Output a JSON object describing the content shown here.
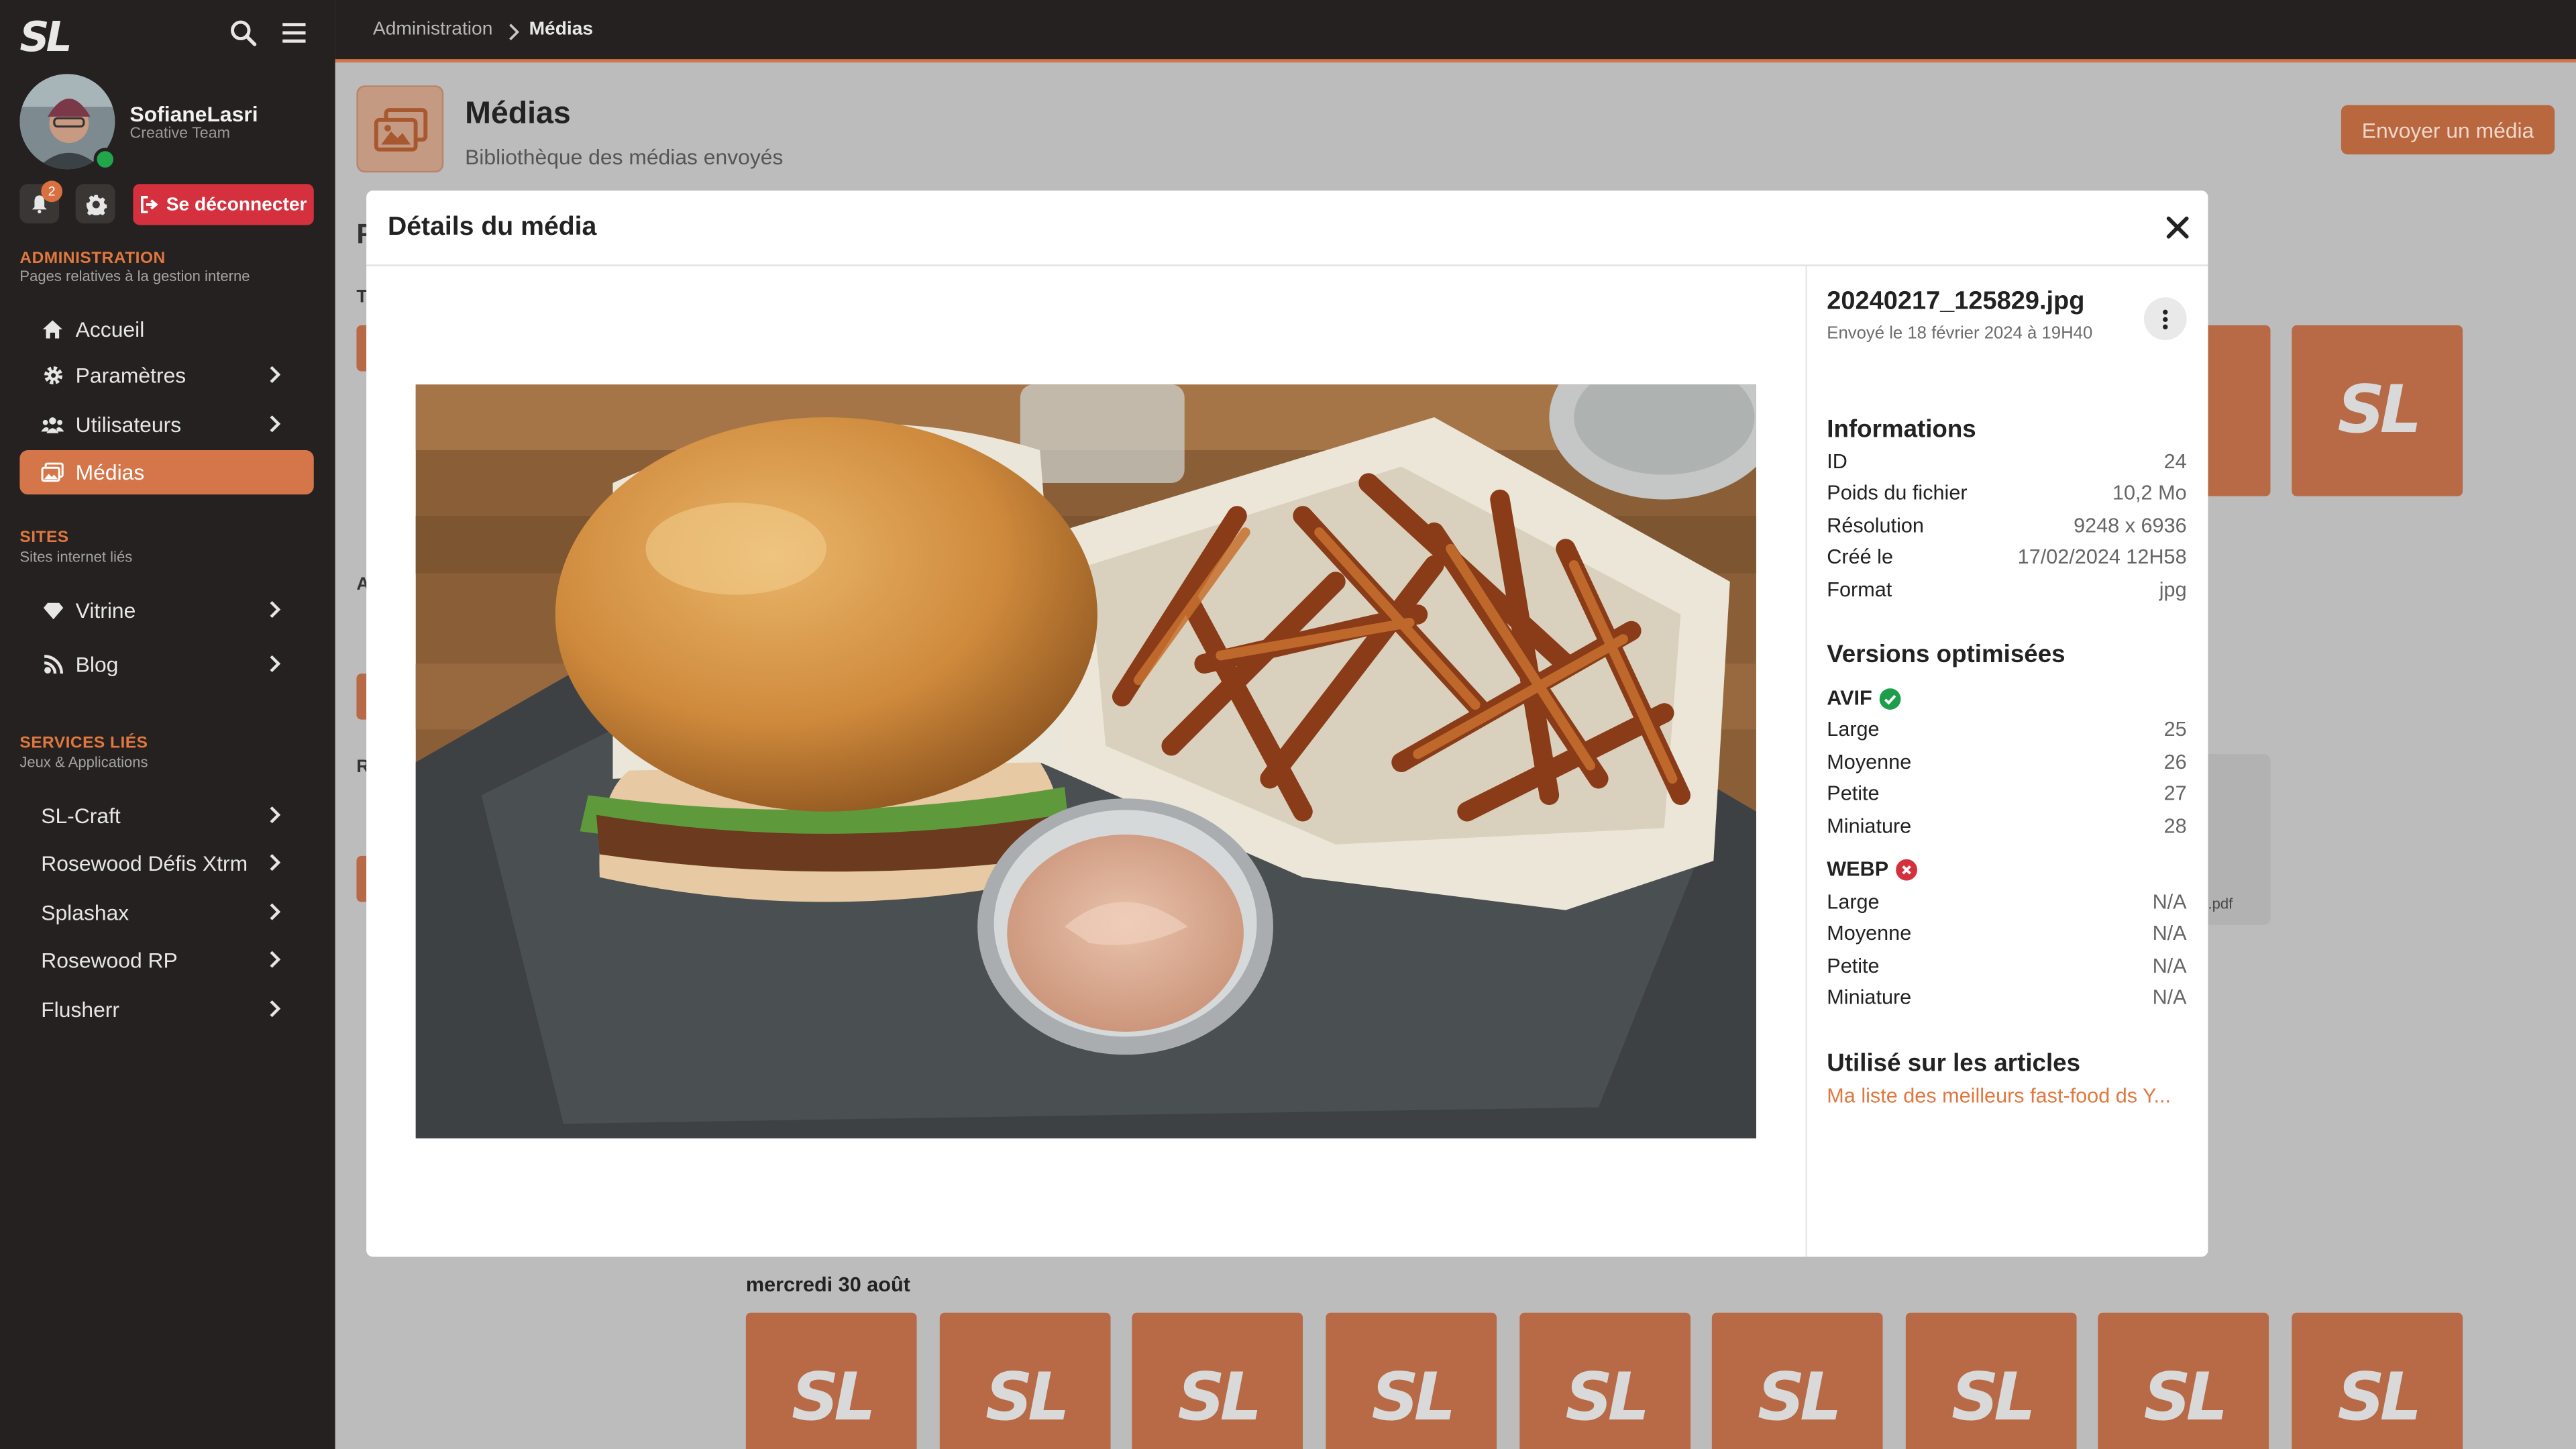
{
  "sidebar": {
    "user": {
      "name": "SofianeLasri",
      "role": "Creative Team"
    },
    "notification_count": "2",
    "logout_label": "Se déconnecter",
    "sections": [
      {
        "title": "Administration",
        "subtitle": "Pages relatives à la gestion interne",
        "items": [
          {
            "label": "Accueil"
          },
          {
            "label": "Paramètres"
          },
          {
            "label": "Utilisateurs"
          },
          {
            "label": "Médias"
          }
        ]
      },
      {
        "title": "Sites",
        "subtitle": "Sites internet liés",
        "items": [
          {
            "label": "Vitrine"
          },
          {
            "label": "Blog"
          }
        ]
      },
      {
        "title": "Services liés",
        "subtitle": "Jeux & Applications",
        "items": [
          {
            "label": "SL-Craft"
          },
          {
            "label": "Rosewood Défis Xtrm"
          },
          {
            "label": "Splashax"
          },
          {
            "label": "Rosewood RP"
          },
          {
            "label": "Flusherr"
          }
        ]
      }
    ]
  },
  "breadcrumb": {
    "items": [
      "Administration",
      "Médias"
    ]
  },
  "page": {
    "title": "Médias",
    "subtitle": "Bibliothèque des médias envoyés",
    "send_button": "Envoyer un média",
    "date_label": "mercredi 30 août",
    "pdf_label": ".pdf",
    "peek_letters": [
      "F",
      "T",
      "A",
      "R"
    ]
  },
  "modal": {
    "title": "Détails du média",
    "file_name": "20240217_125829.jpg",
    "sent_date": "Envoyé le 18 février 2024 à 19H40",
    "info_title": "Informations",
    "info": [
      {
        "label": "ID",
        "value": "24"
      },
      {
        "label": "Poids du fichier",
        "value": "10,2 Mo"
      },
      {
        "label": "Résolution",
        "value": "9248 x 6936"
      },
      {
        "label": "Créé le",
        "value": "17/02/2024 12H58"
      },
      {
        "label": "Format",
        "value": "jpg"
      }
    ],
    "versions_title": "Versions optimisées",
    "formats": [
      {
        "name": "AVIF",
        "status": "ok",
        "color": "#1e9e4a",
        "rows": [
          {
            "label": "Large",
            "value": "25"
          },
          {
            "label": "Moyenne",
            "value": "26"
          },
          {
            "label": "Petite",
            "value": "27"
          },
          {
            "label": "Miniature",
            "value": "28"
          }
        ]
      },
      {
        "name": "WEBP",
        "status": "error",
        "color": "#d5303d",
        "rows": [
          {
            "label": "Large",
            "value": "N/A"
          },
          {
            "label": "Moyenne",
            "value": "N/A"
          },
          {
            "label": "Petite",
            "value": "N/A"
          },
          {
            "label": "Miniature",
            "value": "N/A"
          }
        ]
      }
    ],
    "used_title": "Utilisé sur les articles",
    "articles": [
      "Ma liste des meilleurs fast-food ds Y..."
    ]
  },
  "tile_logo": "SL",
  "colors": {
    "accent": "#d5764a",
    "sidebar_bg": "#242120",
    "danger": "#d5303d",
    "success": "#1e9e4a"
  }
}
